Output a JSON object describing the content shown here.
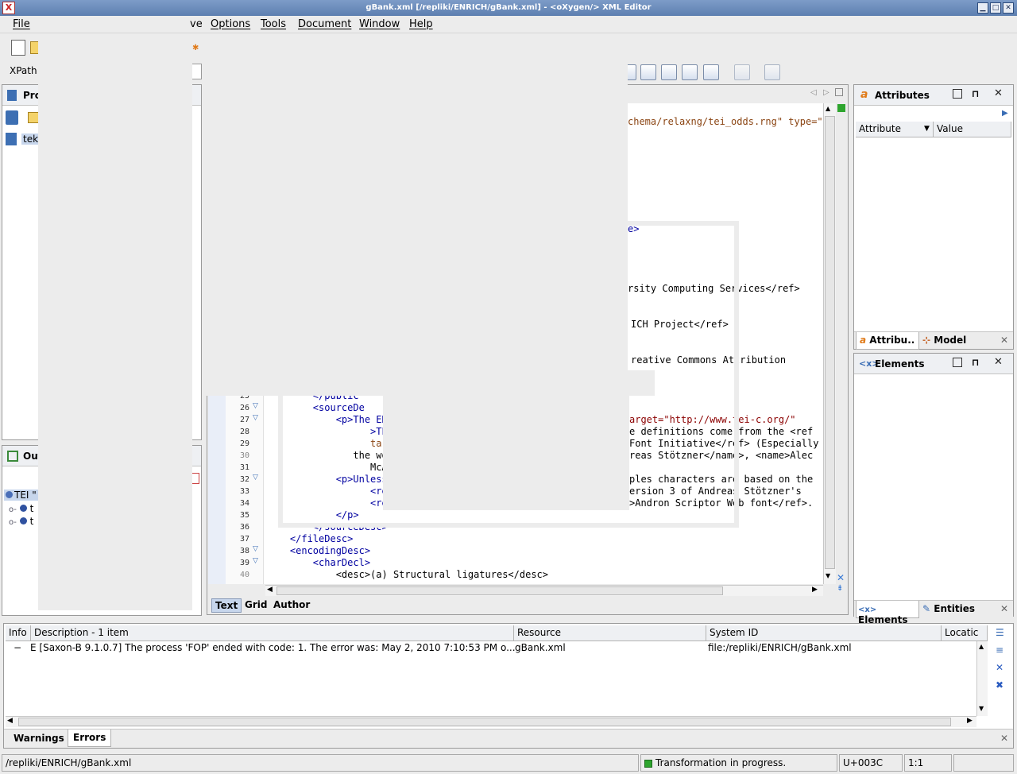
{
  "window": {
    "title": "gBank.xml [/repliki/ENRICH/gBank.xml] - <oXygen/> XML Editor",
    "minimize": "▁",
    "maximize": "□",
    "close": "✕"
  },
  "menu": {
    "file": "File",
    "partial": "ve",
    "options": "Options",
    "tools": "Tools",
    "document": "Document",
    "window": "Window",
    "help": "Help"
  },
  "xpath": {
    "label": "XPath"
  },
  "project": {
    "title": "Pro",
    "item": "teks"
  },
  "outline": {
    "title": "Out",
    "root": "TEI \"",
    "children": [
      "t",
      "t"
    ]
  },
  "editor": {
    "visible_lines_top": [
      {
        "text": "chema/relaxng/tei_odds.rng\" type=\"xr"
      },
      {
        "text": "e>"
      },
      {
        "text": "rsity Computing Services</ref>"
      },
      {
        "text": "ICH Project</ref>"
      },
      {
        "text": "reative Commons Attribution"
      }
    ],
    "lines": [
      {
        "num": "25",
        "fold": false,
        "code": "        </public"
      },
      {
        "num": "26",
        "fold": true,
        "code": "        <sourceDe"
      },
      {
        "num": "27",
        "fold": true,
        "code": "            <p>The ENR"
      },
      {
        "num": "28",
        "fold": false,
        "code": "                  >TEI"
      },
      {
        "num": "29",
        "fold": false,
        "code": "                  targ"
      },
      {
        "num": "30",
        "fold": false,
        "code": "               the wor"
      },
      {
        "num": "31",
        "fold": false,
        "code": "                  McA"
      },
      {
        "num": "32",
        "fold": true,
        "code": "            <p>Unless"
      },
      {
        "num": "33",
        "fold": false,
        "code": "                  <ref"
      },
      {
        "num": "34",
        "fold": false,
        "code": "                  <ref"
      },
      {
        "num": "35",
        "fold": false,
        "code": "            </p>"
      },
      {
        "num": "36",
        "fold": false,
        "code": "        </sourceDesc>"
      },
      {
        "num": "37",
        "fold": false,
        "code": "    </fileDesc>"
      },
      {
        "num": "38",
        "fold": true,
        "code": "    <encodingDesc>"
      },
      {
        "num": "39",
        "fold": true,
        "code": "        <charDecl>"
      },
      {
        "num": "40",
        "fold": false,
        "code": "            <desc>(a) Structural ligatures</desc>"
      }
    ],
    "right_lines": [
      "arget=\"http://www.tei-c.org/\"",
      "e definitions come from the <ref",
      "Font Initiative</ref> (Especially",
      "reas Stötzner</name>, <name>Alec",
      "",
      "ples characters are based on the",
      "ersion 3 of Andreas Stötzner's",
      ">Andron Scriptor Web font</ref>."
    ],
    "tabs": {
      "text": "Text",
      "grid": "Grid",
      "author": "Author"
    }
  },
  "attributes_panel": {
    "title": "Attributes",
    "col_attribute": "Attribute",
    "col_value": "Value",
    "tab1": "Attribu..",
    "tab2": "Model"
  },
  "elements_panel": {
    "title": "Elements",
    "tab1": "Elements",
    "tab2": "Entities"
  },
  "results": {
    "headers": {
      "info": "Info",
      "description": "Description - 1 item",
      "resource": "Resource",
      "system_id": "System ID",
      "location": "Locatic"
    },
    "row": {
      "info": "−",
      "description": "E [Saxon-B 9.1.0.7] The process 'FOP' ended with code: 1. The error was: May 2, 2010 7:10:53 PM o...",
      "resource": "gBank.xml",
      "system_id": "file:/repliki/ENRICH/gBank.xml"
    },
    "tabs": {
      "warnings": "Warnings",
      "errors": "Errors"
    }
  },
  "status": {
    "path": "/repliki/ENRICH/gBank.xml",
    "transform": "Transformation in progress.",
    "unicode": "U+003C",
    "position": "1:1"
  },
  "colors": {
    "title_bar": "#6d8ebe",
    "tag": "#0000a0",
    "attr": "#8b4513",
    "status_green": "#2ea52e"
  }
}
